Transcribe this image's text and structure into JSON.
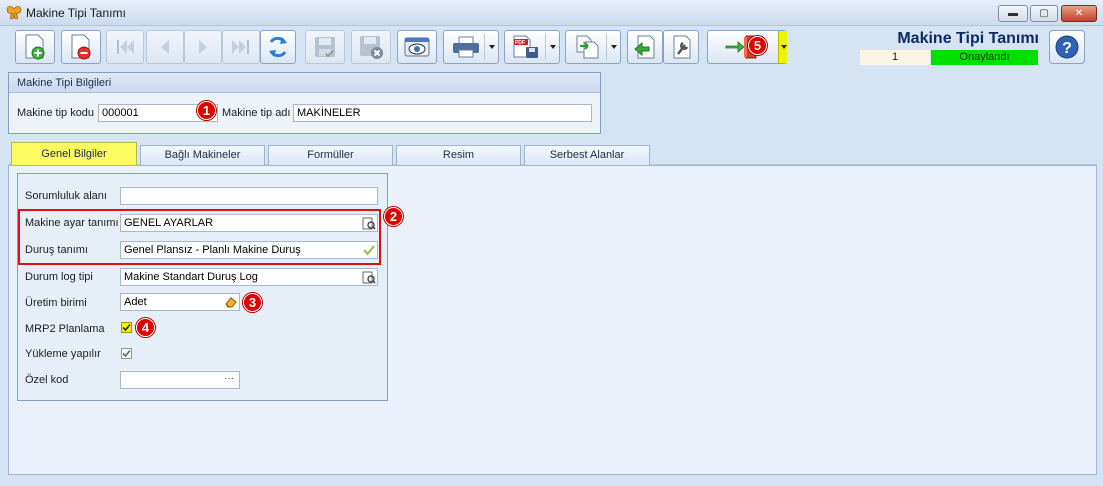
{
  "window": {
    "title": "Makine Tipi Tanımı",
    "controls": {
      "minimize": "▬",
      "maximize": "▢",
      "close": "✕"
    }
  },
  "header": {
    "title": "Makine Tipi Tanımı",
    "record_number": "1",
    "status": "Onaylandı",
    "status_color": "#00e000"
  },
  "toolbar": {
    "buttons": [
      "new-icon",
      "delete-icon",
      "first-icon",
      "previous-icon",
      "next-icon",
      "last-icon",
      "refresh-icon",
      "save-icon",
      "save-close-icon",
      "preview-icon",
      "print-icon",
      "pdf-export-icon",
      "copy-icon",
      "import-icon",
      "settings-tool-icon",
      "exit-icon",
      "help-icon"
    ]
  },
  "group": {
    "title": "Makine Tipi Bilgileri",
    "code_label": "Makine tip kodu",
    "code_value": "000001",
    "name_label": "Makine tip adı",
    "name_value": "MAKİNELER"
  },
  "tabs": [
    {
      "label": "Genel Bilgiler",
      "active": true
    },
    {
      "label": "Bağlı Makineler"
    },
    {
      "label": "Formüller"
    },
    {
      "label": "Resim"
    },
    {
      "label": "Serbest Alanlar"
    }
  ],
  "form": {
    "responsibility": {
      "label": "Sorumluluk alanı",
      "value": ""
    },
    "machine_setting": {
      "label": "Makine ayar tanımı",
      "value": "GENEL AYARLAR"
    },
    "downtime": {
      "label": "Duruş tanımı",
      "value": "Genel Plansız - Planlı Makine Duruş"
    },
    "status_log": {
      "label": "Durum log tipi",
      "value": "Makine Standart Duruş Log"
    },
    "unit": {
      "label": "Üretim birimi",
      "value": "Adet"
    },
    "mrp2": {
      "label": "MRP2 Planlama",
      "checked": true
    },
    "loading": {
      "label": "Yükleme yapılır",
      "checked": true
    },
    "special_code": {
      "label": "Özel kod",
      "value": "",
      "button": "···"
    }
  },
  "annotations": [
    "1",
    "2",
    "3",
    "4",
    "5"
  ],
  "colors": {
    "accent_tab": "#fdfd63",
    "highlight_border": "#e01010",
    "badge": "#e00000"
  }
}
